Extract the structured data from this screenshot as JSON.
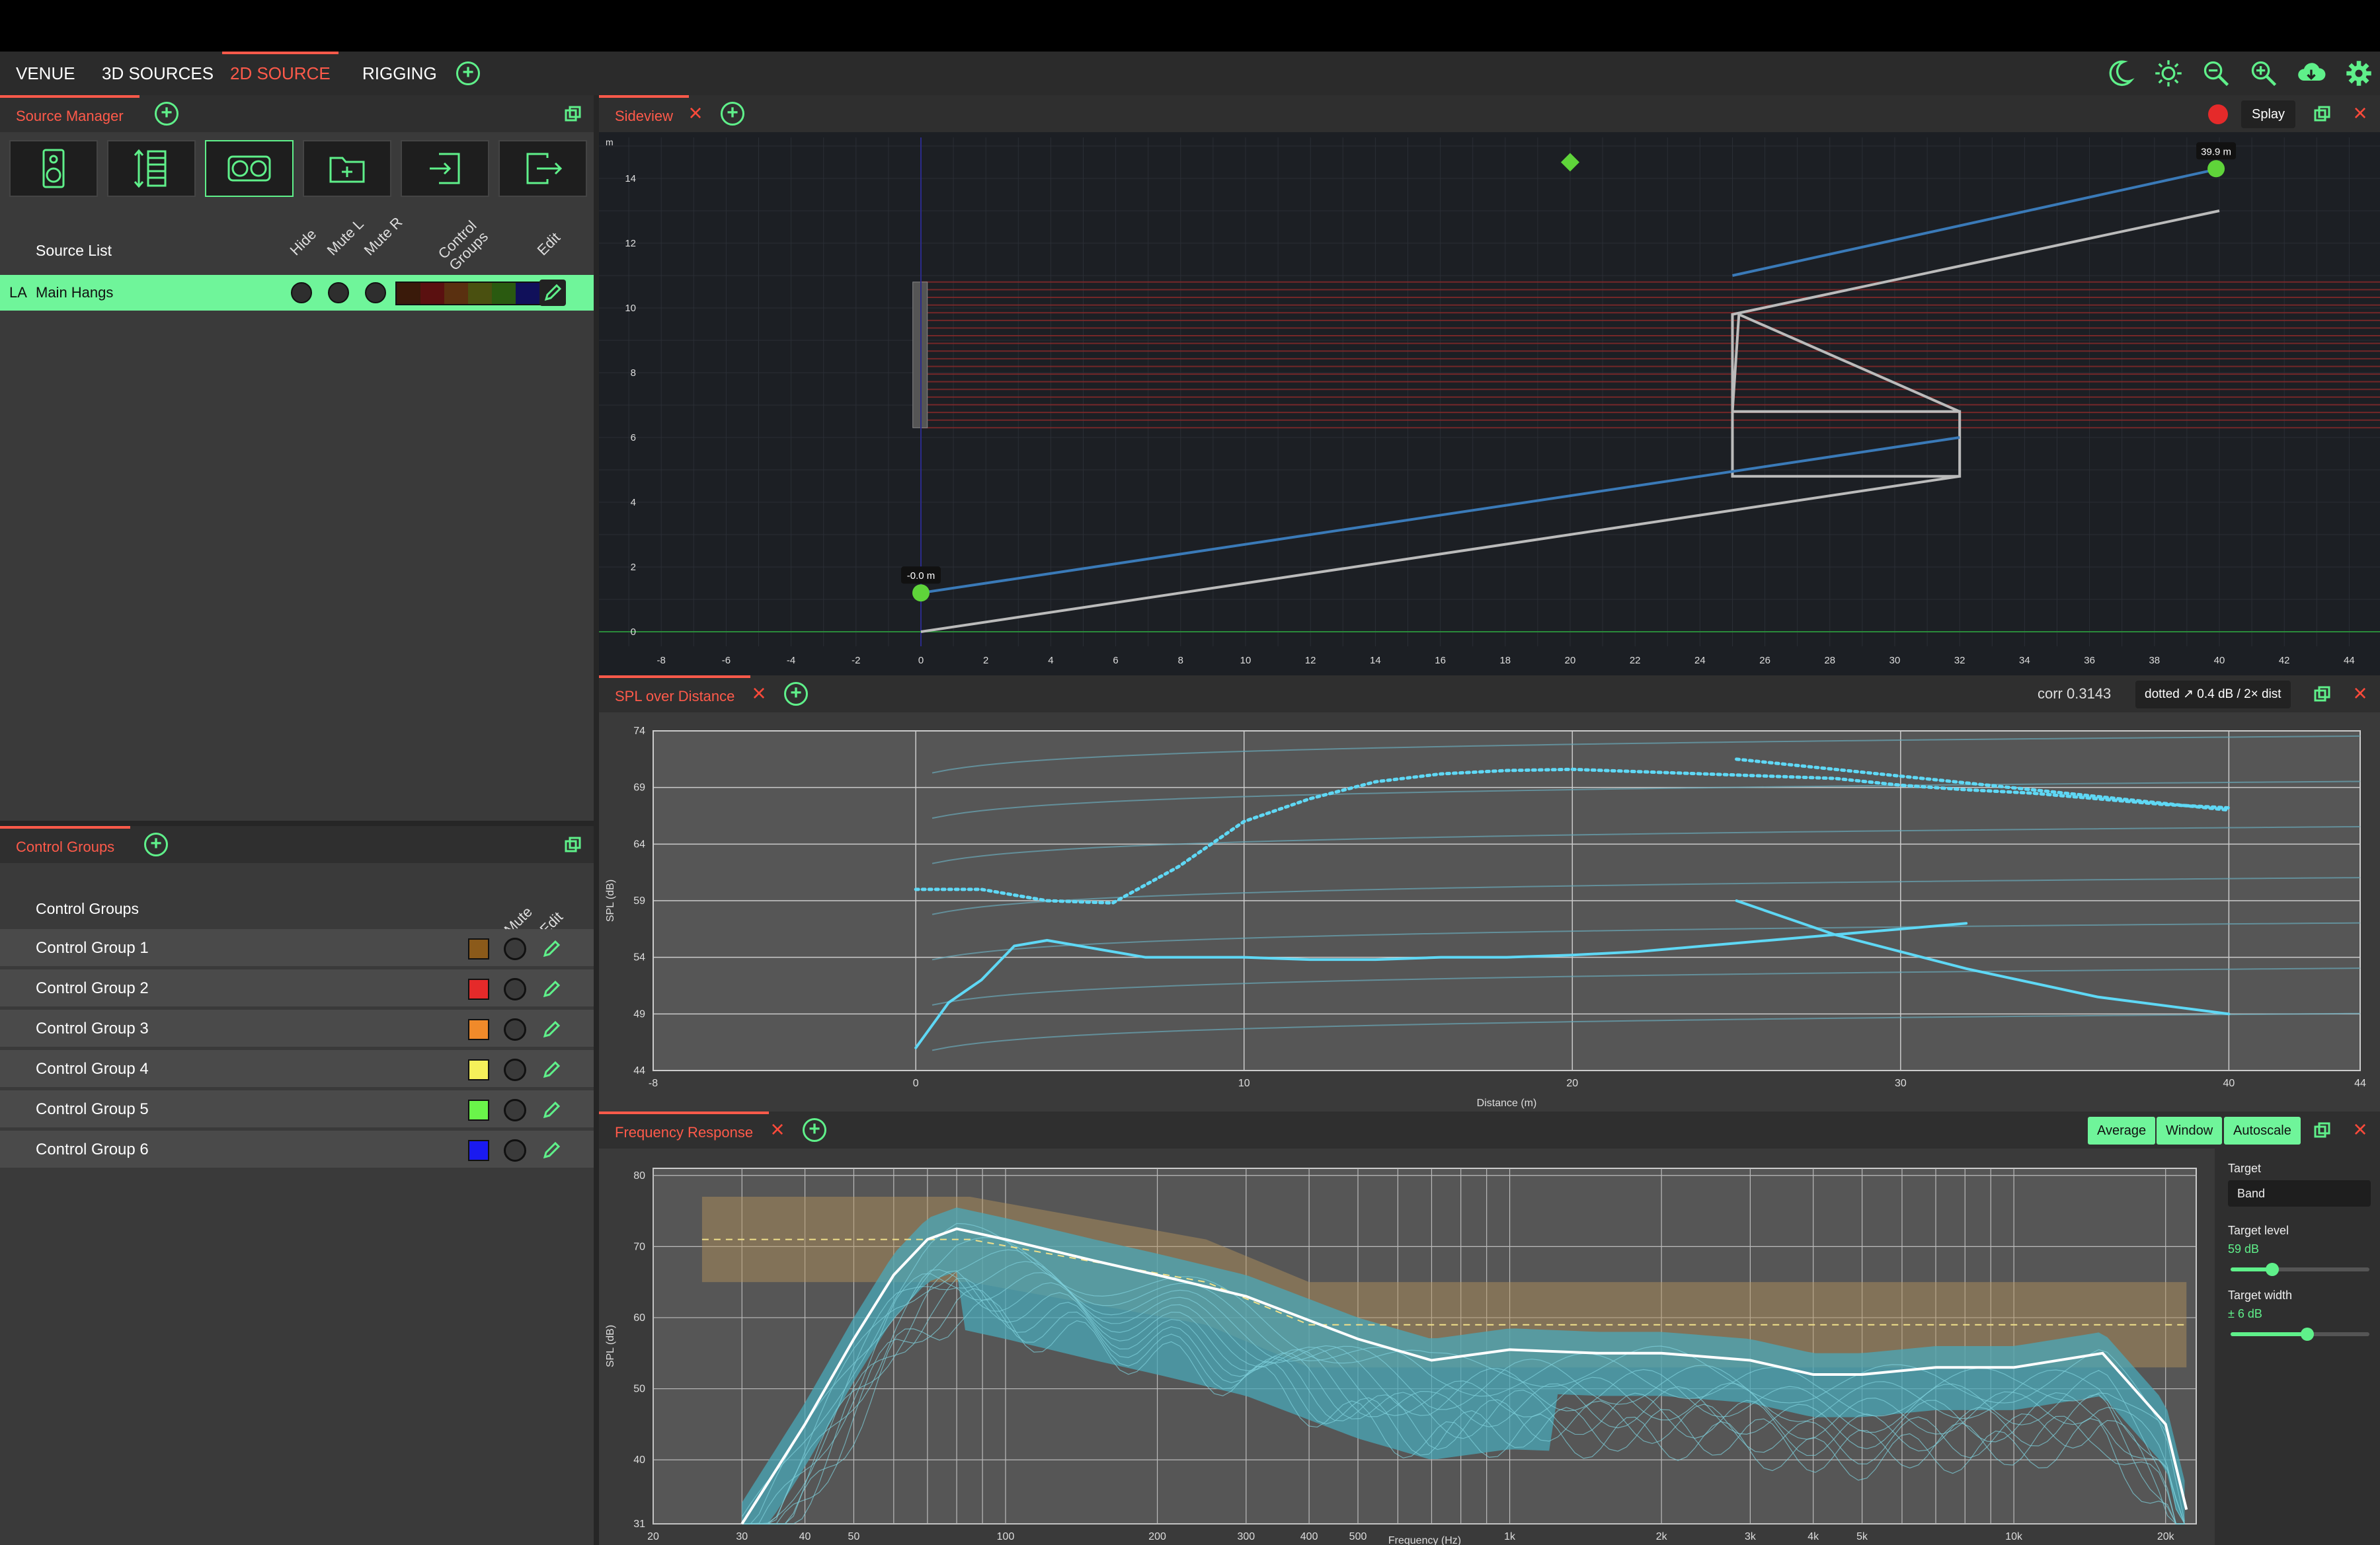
{
  "nav": {
    "tabs": [
      {
        "label": "VENUE"
      },
      {
        "label": "3D SOURCES"
      },
      {
        "label": "2D SOURCE"
      },
      {
        "label": "RIGGING"
      }
    ]
  },
  "colors": {
    "accent": "#5ff08a",
    "active": "#ff5a4a",
    "bg": "#2b2b2b"
  },
  "source_manager": {
    "title": "Source Manager",
    "buttons": [
      "speaker-icon",
      "array-icon",
      "binocular-icon",
      "folder-add-icon",
      "import-icon",
      "export-icon"
    ],
    "list_header": "Source List",
    "columns": [
      "Hide",
      "Mute L",
      "Mute R",
      "Control Groups",
      "Edit"
    ],
    "rows": [
      {
        "type": "LA",
        "name": "Main Hangs",
        "swatches": [
          "#3a1a0a",
          "#5a1010",
          "#5a3010",
          "#4a5010",
          "#2a5a10",
          "#10105a"
        ]
      }
    ]
  },
  "control_groups": {
    "title": "Control Groups",
    "header": "Control Groups",
    "columns": [
      "Mute",
      "Edit"
    ],
    "rows": [
      {
        "name": "Control Group 1",
        "color": "#8b5a1a"
      },
      {
        "name": "Control Group 2",
        "color": "#e52a2a"
      },
      {
        "name": "Control Group 3",
        "color": "#f08a2a"
      },
      {
        "name": "Control Group 4",
        "color": "#f5f05a"
      },
      {
        "name": "Control Group 5",
        "color": "#6af54a"
      },
      {
        "name": "Control Group 6",
        "color": "#1a1af0"
      }
    ]
  },
  "sideview": {
    "title": "Sideview",
    "splay_label": "Splay",
    "label_start": "-0.0 m",
    "label_end": "39.9 m",
    "y_unit": "m"
  },
  "spl": {
    "title": "SPL over Distance",
    "corr": "corr 0.3143",
    "note": "dotted ↗ 0.4 dB / 2× dist"
  },
  "freq": {
    "title": "Frequency Response",
    "buttons": {
      "average": "Average",
      "window": "Window",
      "autoscale": "Autoscale"
    },
    "target_label": "Target",
    "target_value": "Band",
    "target_level_label": "Target level",
    "target_level_value": "59 dB",
    "target_level_fraction": 0.3,
    "target_width_label": "Target width",
    "target_width_value": "± 6 dB",
    "target_width_fraction": 0.55
  },
  "chart_data": [
    {
      "type": "line",
      "title": "Sideview",
      "ylabel": "m",
      "xlim": [
        -9,
        45
      ],
      "ylim": [
        -0.5,
        15.5
      ],
      "x_ticks": [
        -8,
        -6,
        -4,
        -2,
        0,
        2,
        4,
        6,
        8,
        10,
        12,
        14,
        16,
        18,
        20,
        22,
        24,
        26,
        28,
        30,
        32,
        34,
        36,
        38,
        40,
        42,
        44
      ],
      "y_ticks": [
        0,
        2,
        4,
        6,
        8,
        10,
        12,
        14
      ],
      "series": [
        {
          "name": "",
          "x": [
            0,
            32,
            32,
            25,
            25.2,
            32,
            32,
            25,
            25,
            40
          ],
          "y": [
            0,
            4.8,
            6.8,
            6.8,
            9.8,
            6.8,
            4.8,
            4.8,
            9.8,
            13
          ]
        },
        {
          "x": [
            0,
            32
          ],
          "y": [
            1.2,
            6
          ]
        },
        {
          "x": [
            25,
            40
          ],
          "y": [
            11,
            14.3
          ]
        }
      ],
      "markers": [
        {
          "x": 0,
          "y": 1.2,
          "label": "-0.0 m"
        },
        {
          "x": 39.9,
          "y": 14.3,
          "label": "39.9 m"
        },
        {
          "x": 20,
          "y": 14.5,
          "shape": "diamond"
        }
      ],
      "array_y_range": [
        6.3,
        10.8
      ],
      "ray_count": 20
    },
    {
      "type": "line",
      "title": "SPL over Distance",
      "xlabel": "Distance (m)",
      "ylabel": "SPL (dB)",
      "xlim": [
        -8,
        44
      ],
      "ylim": [
        44,
        74
      ],
      "x_ticks": [
        -8,
        0,
        10,
        20,
        30,
        40,
        44
      ],
      "y_ticks": [
        44,
        49,
        54,
        59,
        64,
        69,
        74
      ],
      "series": [
        {
          "name": "",
          "x": [
            0,
            1,
            2,
            3,
            4,
            5,
            6,
            7,
            8,
            9,
            10,
            12,
            14,
            16,
            18,
            20,
            22,
            24,
            26,
            28,
            30,
            32
          ],
          "y": [
            46,
            50,
            52,
            55,
            55.5,
            55,
            54.5,
            54,
            54,
            54,
            54,
            53.8,
            53.8,
            54,
            54,
            54.2,
            54.5,
            55,
            55.5,
            56,
            56.5,
            57
          ]
        },
        {
          "x": [
            25,
            28,
            32,
            36,
            40
          ],
          "y": [
            59,
            56,
            53,
            50.5,
            49
          ]
        },
        {
          "x": [
            0,
            2,
            4,
            6,
            8,
            10,
            12,
            14,
            16,
            18,
            20,
            22,
            24,
            26,
            28,
            30,
            32,
            34,
            36,
            38,
            40
          ],
          "y": [
            60,
            60,
            59,
            58.8,
            62,
            66,
            68,
            69.5,
            70.2,
            70.5,
            70.6,
            70.4,
            70.2,
            70,
            69.8,
            69.2,
            68.8,
            68.5,
            68,
            67.5,
            67.2
          ]
        },
        {
          "x": [
            25,
            30,
            35,
            40
          ],
          "y": [
            71.5,
            70,
            68.5,
            67
          ]
        }
      ]
    },
    {
      "type": "line",
      "title": "Frequency Response",
      "xlabel": "Frequency (Hz)",
      "ylabel": "SPL (dB)",
      "xscale": "log",
      "xlim": [
        20,
        23000
      ],
      "ylim": [
        31,
        81
      ],
      "x_ticks": [
        "20",
        "30",
        "40",
        "50",
        "100",
        "200",
        "300",
        "400",
        "500",
        "1k",
        "2k",
        "3k",
        "4k",
        "5k",
        "10k",
        "20k"
      ],
      "y_ticks": [
        31,
        40,
        50,
        60,
        70,
        80
      ],
      "series": [
        {
          "name": "",
          "x": [
            30,
            40,
            50,
            60,
            70,
            80,
            100,
            150,
            200,
            300,
            500,
            700,
            1000,
            1500,
            2000,
            3000,
            4000,
            5000,
            7000,
            10000,
            15000,
            20000,
            22000
          ],
          "y": [
            31,
            45,
            57,
            66,
            71,
            72.5,
            71,
            68,
            66,
            63,
            57,
            54,
            55.5,
            55,
            55,
            54,
            52,
            52,
            53,
            53,
            55,
            45,
            33
          ]
        },
        {
          "x": [
            25,
            85,
            250,
            400,
            22000
          ],
          "y": [
            71,
            71,
            65,
            59,
            59
          ]
        }
      ]
    }
  ]
}
